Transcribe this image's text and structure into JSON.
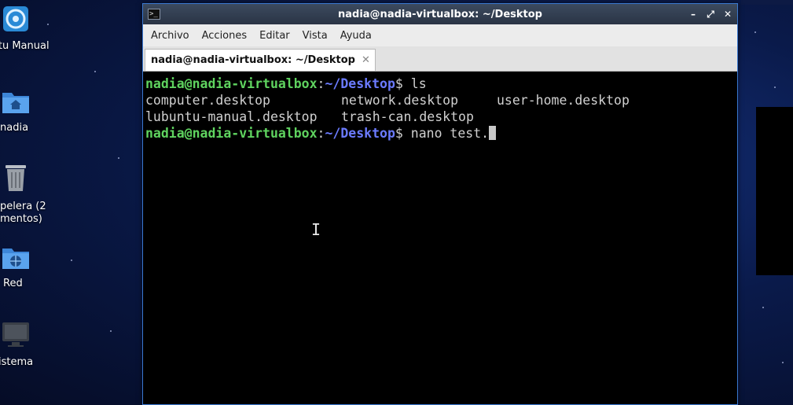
{
  "desktop": {
    "icons": [
      {
        "label": "ıntu Manual",
        "icon": "lubuntu-manual-icon"
      },
      {
        "label": "nadia",
        "icon": "home-folder-icon"
      },
      {
        "label_line1": "pelera (2",
        "label_line2": "mentos)",
        "icon": "trash-icon"
      },
      {
        "label": "Red",
        "icon": "network-icon"
      },
      {
        "label": "istema",
        "icon": "computer-icon"
      }
    ]
  },
  "window": {
    "title": "nadia@nadia-virtualbox: ~/Desktop",
    "controls": {
      "minimize": "–",
      "maximize": "⤢",
      "close": "✕"
    }
  },
  "menubar": {
    "items": [
      "Archivo",
      "Acciones",
      "Editar",
      "Vista",
      "Ayuda"
    ]
  },
  "tabs": [
    {
      "label": "nadia@nadia-virtualbox: ~/Desktop",
      "close": "✕"
    }
  ],
  "terminal": {
    "prompt_user": "nadia@nadia-virtualbox",
    "prompt_sep": ":",
    "prompt_path": "~/Desktop",
    "prompt_symbol": "$",
    "command1": " ls",
    "files": [
      [
        "computer.desktop",
        "network.desktop",
        "user-home.desktop"
      ],
      [
        "lubuntu-manual.desktop",
        "trash-can.desktop",
        ""
      ]
    ],
    "command2": " nano test."
  },
  "colors": {
    "prompt_user": "#5fd35f",
    "prompt_path": "#6b7bff",
    "terminal_bg": "#000000",
    "window_border": "#3a78d0"
  }
}
